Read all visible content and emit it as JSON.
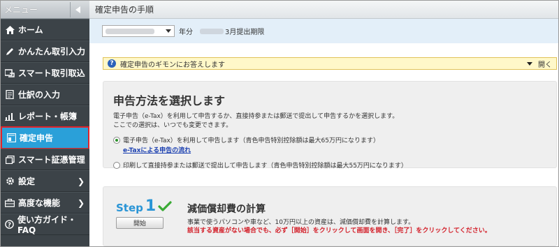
{
  "sidebar": {
    "header_title": "メニュー",
    "items": [
      {
        "label": "ホーム",
        "icon": "home-icon",
        "active": false,
        "has_arrow": false
      },
      {
        "label": "かんたん取引入力",
        "icon": "pencil-icon",
        "active": false,
        "has_arrow": false
      },
      {
        "label": "スマート取引取込",
        "icon": "import-icon",
        "active": false,
        "has_arrow": false
      },
      {
        "label": "仕訳の入力",
        "icon": "ledger-icon",
        "active": false,
        "has_arrow": false
      },
      {
        "label": "レポート・帳簿",
        "icon": "report-chart-icon",
        "active": false,
        "has_arrow": false
      },
      {
        "label": "確定申告",
        "icon": "tax-return-icon",
        "active": true,
        "has_arrow": false
      },
      {
        "label": "スマート証憑管理",
        "icon": "receipt-icon",
        "active": false,
        "has_arrow": false
      },
      {
        "label": "設定",
        "icon": "gear-icon",
        "active": false,
        "has_arrow": true
      },
      {
        "label": "高度な機能",
        "icon": "tools-icon",
        "active": false,
        "has_arrow": true
      },
      {
        "label": "使い方ガイド・FAQ",
        "icon": "help-icon",
        "active": false,
        "has_arrow": false
      }
    ]
  },
  "topbar": {
    "title": "確定申告の手順"
  },
  "yearbar": {
    "year_suffix": "年分",
    "deadline": "3月提出期限"
  },
  "faq": {
    "text": "確定申告のギモンにお答えします",
    "toggle_label": "開く"
  },
  "method_panel": {
    "title": "申告方法を選択します",
    "desc_line1": "電子申告（e-Tax）を利用して申告するか、直接持参または郵送で提出して申告するかを選択します。",
    "desc_line2": "ここでの選択は、いつでも変更できます。",
    "option1": "電子申告（e-Tax）を利用して申告します（青色申告特別控除額は最大65万円になります）",
    "option1_link": "e-Taxによる申告の流れ",
    "option2": "印刷して直接持参または郵送で提出して申告します（青色申告特別控除額は最大55万円になります）"
  },
  "step1": {
    "step_word": "Step",
    "step_number": "1",
    "start_label": "開始",
    "title": "減価償却費の計算",
    "desc": "事業で使うパソコンや車など、10万円以上の資産は、減価償却費を計算します。",
    "note": "該当する資産がない場合でも、必ず［開始］をクリックして画面を開き、［完了］をクリックしてください。"
  },
  "colors": {
    "accent": "#2aa0d9",
    "sidebar_bg": "#3c4348",
    "highlight_border": "#e0232b",
    "note_red": "#d3202a",
    "step_blue": "#2a95d6",
    "check_green": "#3aaa35"
  }
}
